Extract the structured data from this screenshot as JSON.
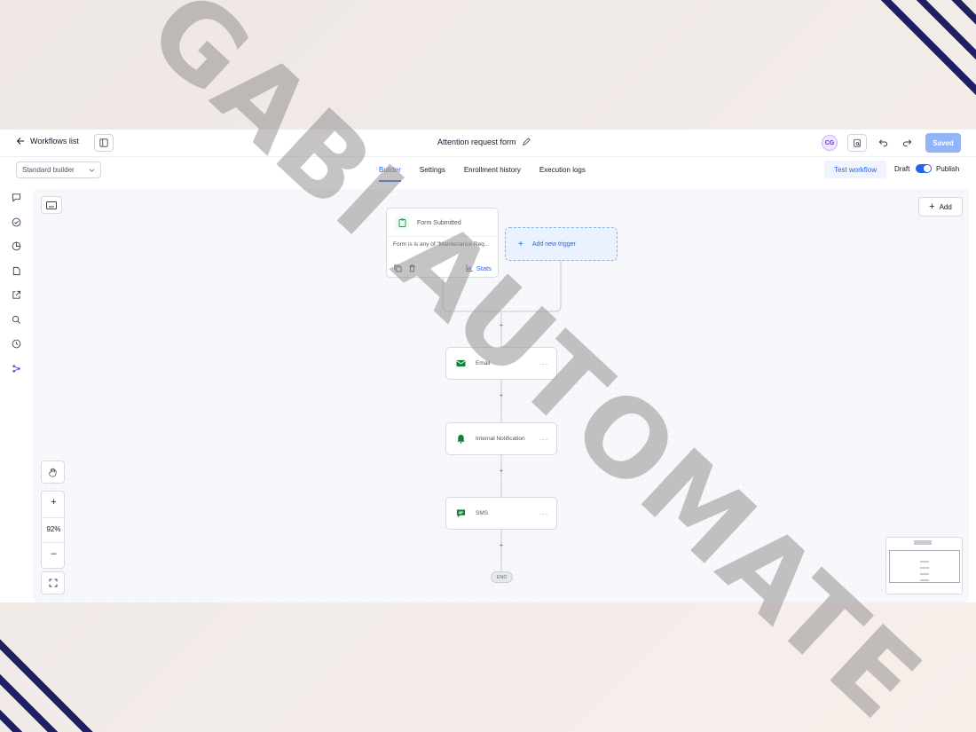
{
  "header": {
    "back_label": "Workflows list",
    "workflow_title": "Attention request form",
    "avatar_initials": "CG",
    "saved_label": "Saved"
  },
  "subbar": {
    "builder_select": "Standard builder",
    "tabs": [
      {
        "label": "Builder",
        "active": true
      },
      {
        "label": "Settings",
        "active": false
      },
      {
        "label": "Enrollment history",
        "active": false
      },
      {
        "label": "Execution logs",
        "active": false
      }
    ],
    "test_workflow_label": "Test workflow",
    "draft_label": "Draft",
    "publish_label": "Publish",
    "publish_toggle_on": true
  },
  "rail_icons": [
    "chat-icon",
    "check-circle-icon",
    "pie-chart-icon",
    "document-icon",
    "external-link-icon",
    "search-icon",
    "history-icon",
    "workflow-icon"
  ],
  "canvas": {
    "add_label": "Add",
    "trigger": {
      "title": "Form Submitted",
      "condition": "Form is is any of \"Maintenance Req...",
      "stats_label": "Stats"
    },
    "new_trigger_label": "Add new trigger",
    "actions": [
      {
        "label": "Email",
        "icon": "email-icon"
      },
      {
        "label": "Internal Notification",
        "icon": "bell-icon"
      },
      {
        "label": "SMS",
        "icon": "sms-icon"
      }
    ],
    "end_label": "END",
    "zoom_level": "92%",
    "zoom_in": "+",
    "zoom_out": "–"
  },
  "watermark_text": "GABI AUTOMATE",
  "colors": {
    "accent": "#2563eb",
    "saved_button": "#93b4f7",
    "stripe": "#14145c",
    "action_icon_green": "#15803d"
  }
}
